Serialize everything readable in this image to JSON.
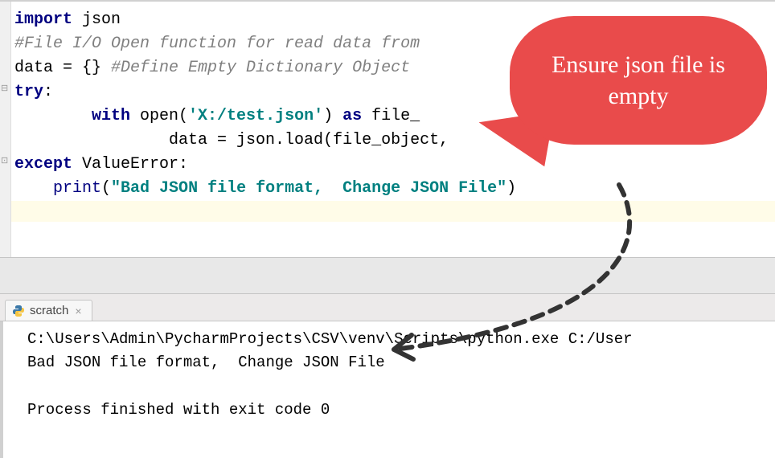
{
  "code": {
    "l1_import": "import",
    "l1_json": " json",
    "l2_comment": "#File I/O Open function for read data from",
    "l3a": "data = {} ",
    "l3b": "#Define Empty Dictionary Object",
    "l4_try": "try",
    "l4_colon": ":",
    "l5a": "        with",
    "l5b": " open(",
    "l5c": "'X:/test.json'",
    "l5d": ") ",
    "l5e": "as",
    "l5f": " file_",
    "l6": "                data = json.load(file_object,",
    "l7_except": "except",
    "l7_err": " ValueError:",
    "l8a": "    print",
    "l8b": "(",
    "l8c": "\"Bad JSON file format,  Change JSON File\"",
    "l8d": ")"
  },
  "tab": {
    "name": "scratch"
  },
  "console": {
    "line1": "C:\\Users\\Admin\\PycharmProjects\\CSV\\venv\\Scripts\\python.exe C:/User",
    "line2": "Bad JSON file format,  Change JSON File",
    "line3": "Process finished with exit code 0"
  },
  "callout": {
    "text": "Ensure json file is empty"
  }
}
